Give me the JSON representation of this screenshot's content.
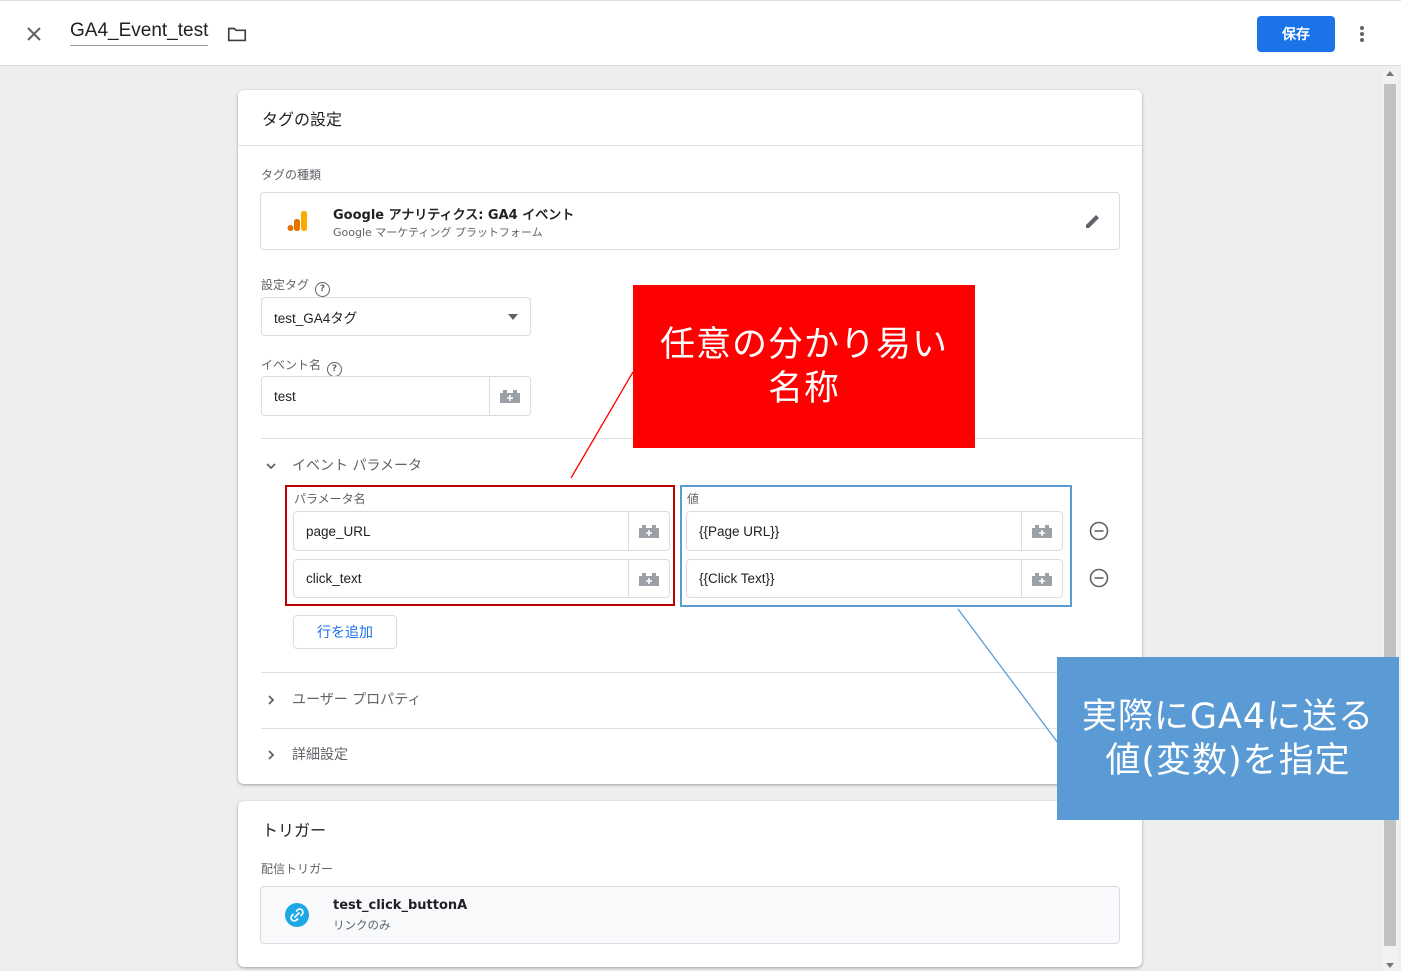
{
  "header": {
    "workspace_title": "GA4_Event_test",
    "save_label": "保存"
  },
  "tag_config": {
    "title": "タグの設定",
    "tag_type_label": "タグの種類",
    "tag_type_name": "Google アナリティクス: GA4 イベント",
    "tag_type_sub": "Google マーケティング プラットフォーム",
    "config_tag_label": "設定タグ",
    "config_tag_value": "test_GA4タグ",
    "event_name_label": "イベント名",
    "event_name_value": "test",
    "event_params_label": "イベント パラメータ",
    "param_name_header": "パラメータ名",
    "value_header": "値",
    "params": [
      {
        "name": "page_URL",
        "value": "{{Page URL}}"
      },
      {
        "name": "click_text",
        "value": "{{Click Text}}"
      }
    ],
    "add_row_label": "行を追加",
    "user_props_label": "ユーザー プロパティ",
    "advanced_label": "詳細設定"
  },
  "trigger": {
    "title": "トリガー",
    "firing_label": "配信トリガー",
    "name": "test_click_buttonA",
    "sub": "リンクのみ"
  },
  "annotations": {
    "red_text": "任意の分かり易い\n名称",
    "blue_text": "実際にGA4に送る\n値(変数)を指定"
  },
  "colors": {
    "accent": "#1a73e8",
    "annotation_red": "#ff0000",
    "annotation_blue": "#5b9bd5",
    "ga_orange": "#f9ab00",
    "ga_dark_orange": "#e37400",
    "link_trigger_blue": "#1ea7e4"
  }
}
